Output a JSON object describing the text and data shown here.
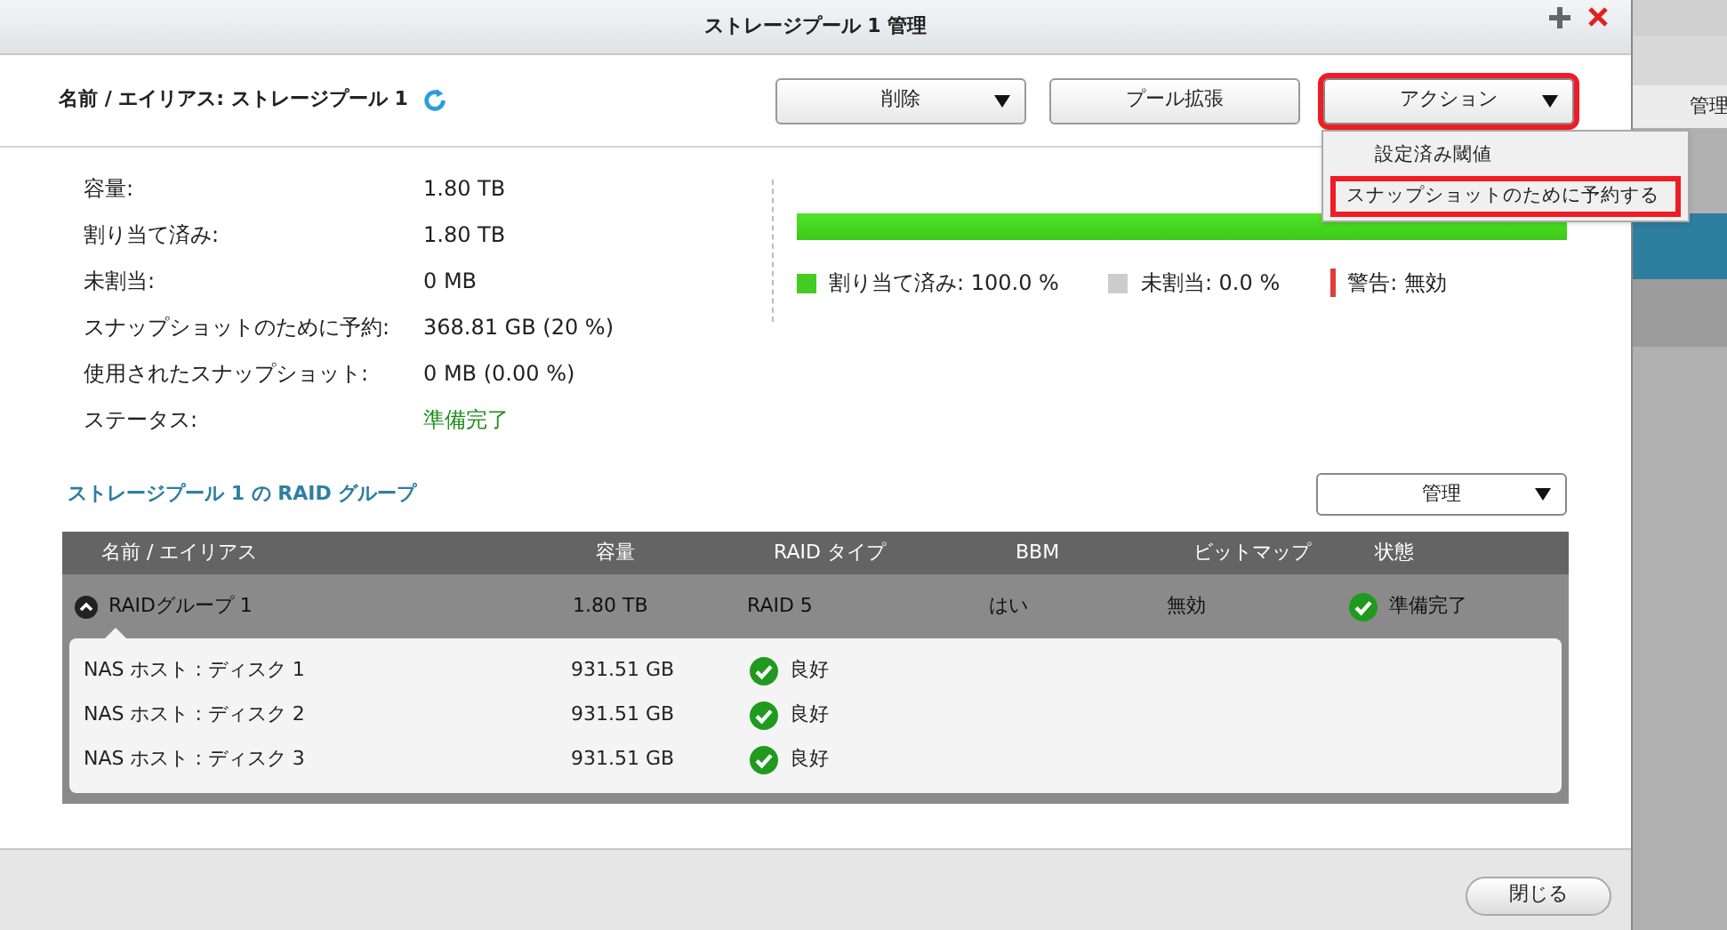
{
  "window": {
    "title": "ストレージプール 1 管理"
  },
  "header": {
    "name_label": "名前 / エイリアス: ストレージプール 1",
    "buttons": [
      {
        "label": "削除",
        "has_caret": true,
        "highlighted": false
      },
      {
        "label": "プール拡張",
        "has_caret": false,
        "highlighted": false
      },
      {
        "label": "アクション",
        "has_caret": true,
        "highlighted": true
      }
    ]
  },
  "action_menu": [
    {
      "label": "設定済み閾値",
      "highlighted": false
    },
    {
      "label": "スナップショットのために予約する",
      "highlighted": true
    }
  ],
  "background_panel": {
    "button": "管理"
  },
  "info": [
    {
      "label": "容量:",
      "value": "1.80 TB",
      "kind": "plain"
    },
    {
      "label": "割り当て済み:",
      "value": "1.80 TB",
      "kind": "plain"
    },
    {
      "label": "未割当:",
      "value": "0 MB",
      "kind": "plain"
    },
    {
      "label": "スナップショットのために予約:",
      "value": "368.81 GB (20 %)",
      "kind": "plain"
    },
    {
      "label": "使用されたスナップショット:",
      "value": "0 MB (0.00 %)",
      "kind": "plain"
    },
    {
      "label": "ステータス:",
      "value": "準備完了",
      "kind": "status"
    }
  ],
  "usage": {
    "level": 1.0,
    "legend": [
      {
        "label": "割り当て済み: 100.0 %",
        "color": "#44cc22",
        "kind": "square"
      },
      {
        "label": "未割当: 0.0 %",
        "color": "#cccccc",
        "kind": "square"
      },
      {
        "label": "警告: 無効",
        "color": "#e03c3c",
        "kind": "line"
      }
    ]
  },
  "raid_section": {
    "title": "ストレージプール 1 の RAID グループ",
    "manage_button": "管理"
  },
  "table": {
    "columns": [
      "名前 / エイリアス",
      "容量",
      "RAID タイプ",
      "BBM",
      "ビットマップ",
      "状態"
    ],
    "group": {
      "name": "RAIDグループ 1",
      "expanded": true,
      "capacity": "1.80 TB",
      "raid_type": "RAID 5",
      "bbm": "はい",
      "bitmap": "無効",
      "status": "準備完了"
    },
    "disks": [
      {
        "name": "NAS ホスト : ディスク 1",
        "capacity": "931.51 GB",
        "status": "良好"
      },
      {
        "name": "NAS ホスト : ディスク 2",
        "capacity": "931.51 GB",
        "status": "良好"
      },
      {
        "name": "NAS ホスト : ディスク 3",
        "capacity": "931.51 GB",
        "status": "良好"
      }
    ]
  },
  "footer": {
    "close_button": "閉じる"
  }
}
